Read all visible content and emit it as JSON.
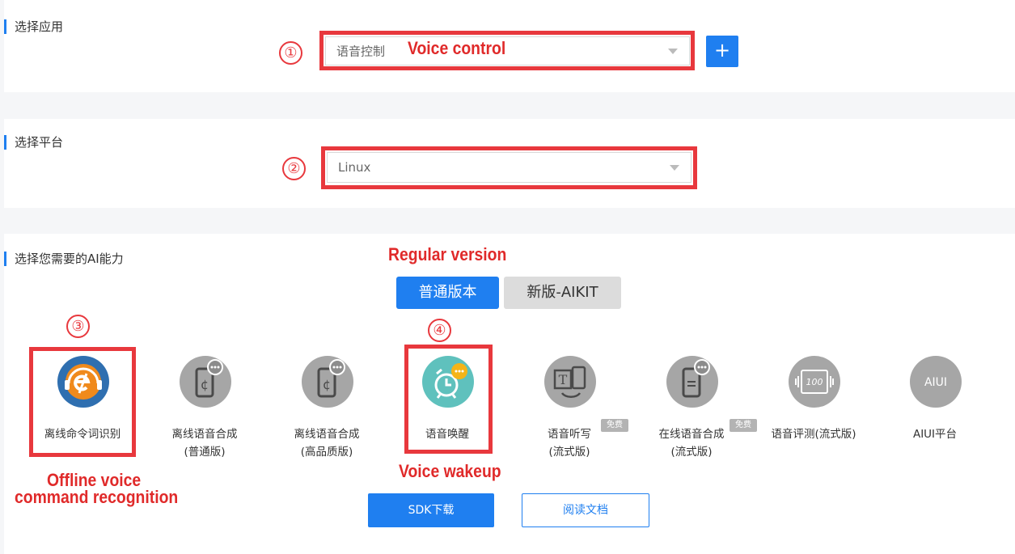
{
  "sections": {
    "select_app": {
      "title": "选择应用",
      "value": "语音控制",
      "add_label": "+"
    },
    "select_platform": {
      "title": "选择平台",
      "value": "Linux"
    },
    "select_ability": {
      "title": "选择您需要的AI能力"
    }
  },
  "tabs": [
    {
      "label": "普通版本",
      "active": true
    },
    {
      "label": "新版-AIKIT",
      "active": false
    }
  ],
  "capabilities": [
    {
      "label": "离线命令词识别",
      "label2": "",
      "icon": "offline-command-icon",
      "free": ""
    },
    {
      "label": "离线语音合成",
      "label2": "(普通版)",
      "icon": "phone-tts-icon",
      "free": ""
    },
    {
      "label": "离线语音合成",
      "label2": "(高品质版)",
      "icon": "phone-tts-hq-icon",
      "free": ""
    },
    {
      "label": "语音唤醒",
      "label2": "",
      "icon": "alarm-clock-icon",
      "free": ""
    },
    {
      "label": "语音听写",
      "label2": "(流式版)",
      "icon": "dictation-icon",
      "free": "免费"
    },
    {
      "label": "在线语音合成",
      "label2": "(流式版)",
      "icon": "online-tts-icon",
      "free": "免费"
    },
    {
      "label": "语音评测(流式版)",
      "label2": "",
      "icon": "evaluation-icon",
      "free": ""
    },
    {
      "label": "AIUI平台",
      "label2": "",
      "icon": "aiui-icon",
      "free": ""
    }
  ],
  "buttons": {
    "sdk": "SDK下载",
    "docs": "阅读文档"
  },
  "annotations": {
    "n1": "①",
    "n2": "②",
    "n3": "③",
    "n4": "④",
    "voice_control": "Voice control",
    "regular_version": "Regular version",
    "offline_line1": "Offline voice",
    "offline_line2": "command recognition",
    "voice_wakeup": "Voice wakeup"
  },
  "colors": {
    "accent": "#1f7ff0",
    "highlight": "#e8383d",
    "annotation": "#e02a2a",
    "icon_grey": "#a6a6a6",
    "icon_teal": "#5fc1bd",
    "icon_blue": "#2f6fb0",
    "icon_orange": "#f08a1c"
  }
}
